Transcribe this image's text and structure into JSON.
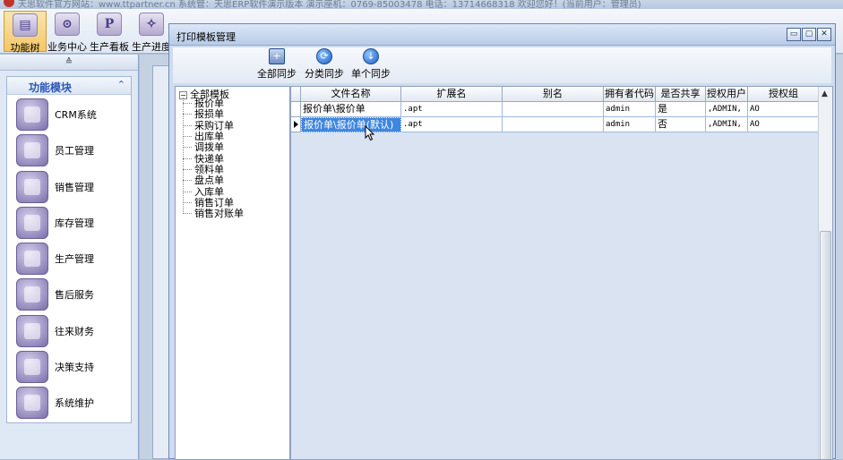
{
  "top_strip": {
    "text": "天思软件官方网站：www.ttpartner.cn 系统管：天思ERP软件演示版本 演示座机：0769-85003478 电话：13714668318 欢迎您好！(当前用户：管理员)"
  },
  "toolbar": {
    "items": [
      {
        "label": "功能树",
        "icon_glyph": "▤",
        "icon": "tree-icon"
      },
      {
        "label": "业务中心",
        "icon_glyph": "⊙",
        "icon": "business-center-icon"
      },
      {
        "label": "生产看板",
        "icon_glyph": "P",
        "icon": "production-board-icon"
      },
      {
        "label": "生产进度",
        "icon_glyph": "✧",
        "icon": "production-progress-icon"
      }
    ]
  },
  "sidebar": {
    "collapse_glyph": "≙",
    "panel_title": "功能模块",
    "panel_collapse_glyph": "⌃",
    "modules": [
      {
        "label": "CRM系统",
        "icon": "crm-icon"
      },
      {
        "label": "员工管理",
        "icon": "employee-icon"
      },
      {
        "label": "销售管理",
        "icon": "sales-icon"
      },
      {
        "label": "库存管理",
        "icon": "inventory-icon"
      },
      {
        "label": "生产管理",
        "icon": "production-icon"
      },
      {
        "label": "售后服务",
        "icon": "after-sales-icon"
      },
      {
        "label": "往来财务",
        "icon": "finance-icon"
      },
      {
        "label": "决策支持",
        "icon": "decision-icon"
      },
      {
        "label": "系统维护",
        "icon": "gear-icon"
      }
    ]
  },
  "dialog": {
    "title": "打印模板管理",
    "window_buttons": {
      "minimize": "▭",
      "maximize": "▢",
      "close": "✕"
    },
    "toolbar": {
      "all_sync": "全部同步",
      "category_sync": "分类同步",
      "single_sync": "单个同步"
    },
    "tree": {
      "expander": "−",
      "root": "全部模板",
      "children": [
        "报价单",
        "报损单",
        "采购订单",
        "出库单",
        "调拨单",
        "快递单",
        "领料单",
        "盘点单",
        "入库单",
        "销售订单",
        "销售对账单"
      ]
    },
    "grid": {
      "columns": [
        "文件名称",
        "扩展名",
        "别名",
        "拥有者代码",
        "是否共享",
        "授权用户",
        "授权组"
      ],
      "rows": [
        {
          "file_name": "报价单\\报价单",
          "ext": ".apt",
          "alias": "",
          "owner": "admin",
          "shared": "是",
          "users": ",ADMIN,",
          "group": "AO"
        },
        {
          "file_name": "报价单\\报价单(默认)",
          "ext": ".apt",
          "alias": "",
          "owner": "admin",
          "shared": "否",
          "users": ",ADMIN,",
          "group": "AO"
        }
      ],
      "scroll_up_glyph": "▲"
    }
  }
}
